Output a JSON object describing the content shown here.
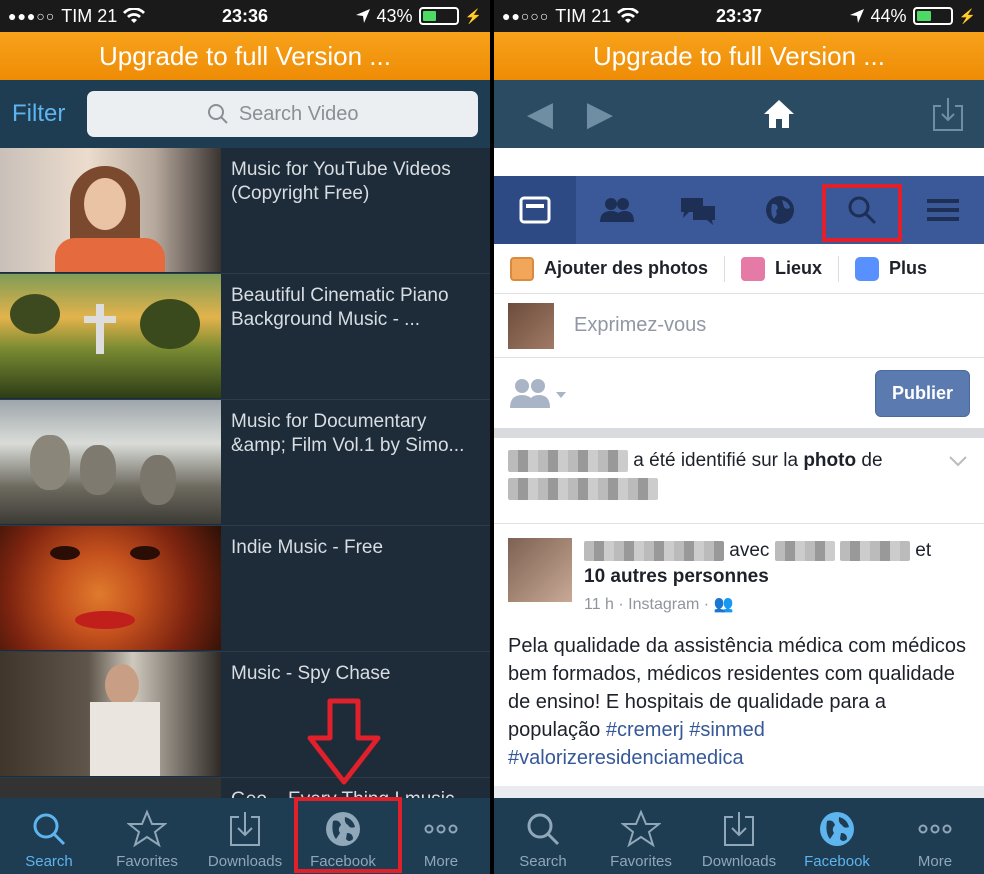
{
  "left": {
    "status": {
      "carrier": "TIM 21",
      "time": "23:36",
      "battery": "43%",
      "battery_level": 0.43
    },
    "upgrade_banner": "Upgrade to full Version ...",
    "filter_label": "Filter",
    "search": {
      "placeholder": "Search Video"
    },
    "videos": [
      {
        "title": "Music for YouTube Videos (Copyright Free)"
      },
      {
        "title": "Beautiful Cinematic Piano Background Music - ..."
      },
      {
        "title": "Music for Documentary &amp; Film Vol.1 by Simo..."
      },
      {
        "title": "Indie Music - Free"
      },
      {
        "title": "Music - Spy Chase"
      },
      {
        "title": "Geo... Every Thing I music"
      }
    ],
    "tabs": [
      {
        "label": "Search",
        "icon": "search-icon",
        "active": true
      },
      {
        "label": "Favorites",
        "icon": "star-icon",
        "active": false
      },
      {
        "label": "Downloads",
        "icon": "download-icon",
        "active": false
      },
      {
        "label": "Facebook",
        "icon": "globe-icon",
        "active": false
      },
      {
        "label": "More",
        "icon": "more-icon",
        "active": false
      }
    ]
  },
  "right": {
    "status": {
      "carrier": "TIM 21",
      "time": "23:37",
      "battery": "44%",
      "battery_level": 0.44
    },
    "upgrade_banner": "Upgrade to full Version ...",
    "facebook": {
      "actions": {
        "photos": "Ajouter des photos",
        "places": "Lieux",
        "more": "Plus"
      },
      "composer_placeholder": "Exprimez-vous",
      "publish": "Publier",
      "tag_notice": {
        "text": "a été identifié sur la",
        "bold": "photo",
        "suffix": "de"
      },
      "post": {
        "with": "avec",
        "et": "et",
        "others": "10 autres personnes",
        "meta": "11 h · Instagram ·",
        "text": "Pela qualidade da assistência médica com médicos bem formados, médicos residentes com qualidade de ensino! E hospitais de qualidade para a população",
        "hashtags": [
          "#cremerj",
          "#sinmed",
          "#valorizeresidenciamedica"
        ]
      }
    },
    "tabs": [
      {
        "label": "Search",
        "icon": "search-icon",
        "active": false
      },
      {
        "label": "Favorites",
        "icon": "star-icon",
        "active": false
      },
      {
        "label": "Downloads",
        "icon": "download-icon",
        "active": false
      },
      {
        "label": "Facebook",
        "icon": "globe-icon",
        "active": true
      },
      {
        "label": "More",
        "icon": "more-icon",
        "active": false
      }
    ]
  },
  "colors": {
    "accent": "#5db4ee",
    "banner": "#f39a12",
    "facebook_blue": "#3b5998",
    "annotation_red": "#e0202a"
  }
}
